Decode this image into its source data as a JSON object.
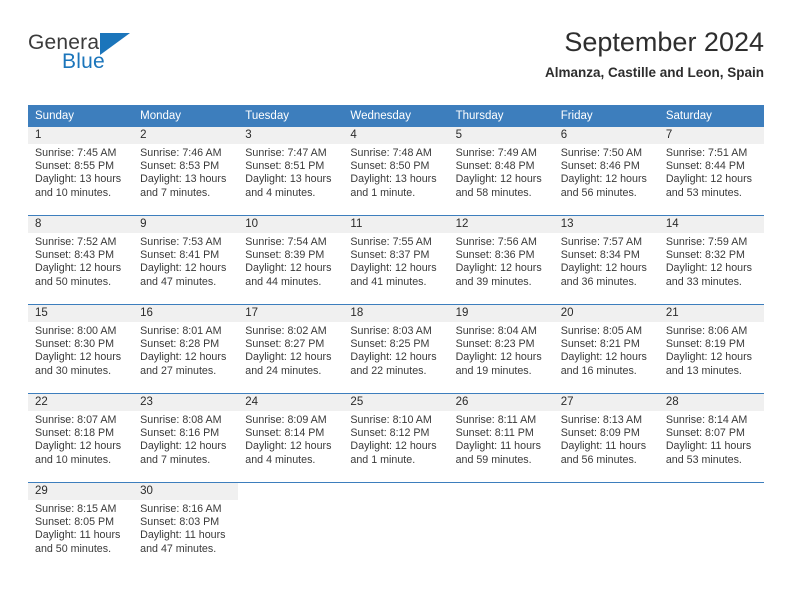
{
  "brand": {
    "name_top": "General",
    "name_bottom": "Blue",
    "color_top": "#3b3b3b",
    "color_bottom": "#1b75bb",
    "triangle_color": "#1b75bb"
  },
  "header": {
    "title": "September 2024",
    "subtitle": "Almanza, Castille and Leon, Spain"
  },
  "theme": {
    "header_bg": "#3d7ebd",
    "header_text": "#ffffff",
    "daynum_band_bg": "#f0f0f0",
    "week_separator": "#3d7ebd",
    "body_text": "#3a3a3a"
  },
  "weekday_headers": [
    "Sunday",
    "Monday",
    "Tuesday",
    "Wednesday",
    "Thursday",
    "Friday",
    "Saturday"
  ],
  "weeks": [
    [
      {
        "day": "1",
        "sunrise": "Sunrise: 7:45 AM",
        "sunset": "Sunset: 8:55 PM",
        "daylight": "Daylight: 13 hours and 10 minutes."
      },
      {
        "day": "2",
        "sunrise": "Sunrise: 7:46 AM",
        "sunset": "Sunset: 8:53 PM",
        "daylight": "Daylight: 13 hours and 7 minutes."
      },
      {
        "day": "3",
        "sunrise": "Sunrise: 7:47 AM",
        "sunset": "Sunset: 8:51 PM",
        "daylight": "Daylight: 13 hours and 4 minutes."
      },
      {
        "day": "4",
        "sunrise": "Sunrise: 7:48 AM",
        "sunset": "Sunset: 8:50 PM",
        "daylight": "Daylight: 13 hours and 1 minute."
      },
      {
        "day": "5",
        "sunrise": "Sunrise: 7:49 AM",
        "sunset": "Sunset: 8:48 PM",
        "daylight": "Daylight: 12 hours and 58 minutes."
      },
      {
        "day": "6",
        "sunrise": "Sunrise: 7:50 AM",
        "sunset": "Sunset: 8:46 PM",
        "daylight": "Daylight: 12 hours and 56 minutes."
      },
      {
        "day": "7",
        "sunrise": "Sunrise: 7:51 AM",
        "sunset": "Sunset: 8:44 PM",
        "daylight": "Daylight: 12 hours and 53 minutes."
      }
    ],
    [
      {
        "day": "8",
        "sunrise": "Sunrise: 7:52 AM",
        "sunset": "Sunset: 8:43 PM",
        "daylight": "Daylight: 12 hours and 50 minutes."
      },
      {
        "day": "9",
        "sunrise": "Sunrise: 7:53 AM",
        "sunset": "Sunset: 8:41 PM",
        "daylight": "Daylight: 12 hours and 47 minutes."
      },
      {
        "day": "10",
        "sunrise": "Sunrise: 7:54 AM",
        "sunset": "Sunset: 8:39 PM",
        "daylight": "Daylight: 12 hours and 44 minutes."
      },
      {
        "day": "11",
        "sunrise": "Sunrise: 7:55 AM",
        "sunset": "Sunset: 8:37 PM",
        "daylight": "Daylight: 12 hours and 41 minutes."
      },
      {
        "day": "12",
        "sunrise": "Sunrise: 7:56 AM",
        "sunset": "Sunset: 8:36 PM",
        "daylight": "Daylight: 12 hours and 39 minutes."
      },
      {
        "day": "13",
        "sunrise": "Sunrise: 7:57 AM",
        "sunset": "Sunset: 8:34 PM",
        "daylight": "Daylight: 12 hours and 36 minutes."
      },
      {
        "day": "14",
        "sunrise": "Sunrise: 7:59 AM",
        "sunset": "Sunset: 8:32 PM",
        "daylight": "Daylight: 12 hours and 33 minutes."
      }
    ],
    [
      {
        "day": "15",
        "sunrise": "Sunrise: 8:00 AM",
        "sunset": "Sunset: 8:30 PM",
        "daylight": "Daylight: 12 hours and 30 minutes."
      },
      {
        "day": "16",
        "sunrise": "Sunrise: 8:01 AM",
        "sunset": "Sunset: 8:28 PM",
        "daylight": "Daylight: 12 hours and 27 minutes."
      },
      {
        "day": "17",
        "sunrise": "Sunrise: 8:02 AM",
        "sunset": "Sunset: 8:27 PM",
        "daylight": "Daylight: 12 hours and 24 minutes."
      },
      {
        "day": "18",
        "sunrise": "Sunrise: 8:03 AM",
        "sunset": "Sunset: 8:25 PM",
        "daylight": "Daylight: 12 hours and 22 minutes."
      },
      {
        "day": "19",
        "sunrise": "Sunrise: 8:04 AM",
        "sunset": "Sunset: 8:23 PM",
        "daylight": "Daylight: 12 hours and 19 minutes."
      },
      {
        "day": "20",
        "sunrise": "Sunrise: 8:05 AM",
        "sunset": "Sunset: 8:21 PM",
        "daylight": "Daylight: 12 hours and 16 minutes."
      },
      {
        "day": "21",
        "sunrise": "Sunrise: 8:06 AM",
        "sunset": "Sunset: 8:19 PM",
        "daylight": "Daylight: 12 hours and 13 minutes."
      }
    ],
    [
      {
        "day": "22",
        "sunrise": "Sunrise: 8:07 AM",
        "sunset": "Sunset: 8:18 PM",
        "daylight": "Daylight: 12 hours and 10 minutes."
      },
      {
        "day": "23",
        "sunrise": "Sunrise: 8:08 AM",
        "sunset": "Sunset: 8:16 PM",
        "daylight": "Daylight: 12 hours and 7 minutes."
      },
      {
        "day": "24",
        "sunrise": "Sunrise: 8:09 AM",
        "sunset": "Sunset: 8:14 PM",
        "daylight": "Daylight: 12 hours and 4 minutes."
      },
      {
        "day": "25",
        "sunrise": "Sunrise: 8:10 AM",
        "sunset": "Sunset: 8:12 PM",
        "daylight": "Daylight: 12 hours and 1 minute."
      },
      {
        "day": "26",
        "sunrise": "Sunrise: 8:11 AM",
        "sunset": "Sunset: 8:11 PM",
        "daylight": "Daylight: 11 hours and 59 minutes."
      },
      {
        "day": "27",
        "sunrise": "Sunrise: 8:13 AM",
        "sunset": "Sunset: 8:09 PM",
        "daylight": "Daylight: 11 hours and 56 minutes."
      },
      {
        "day": "28",
        "sunrise": "Sunrise: 8:14 AM",
        "sunset": "Sunset: 8:07 PM",
        "daylight": "Daylight: 11 hours and 53 minutes."
      }
    ],
    [
      {
        "day": "29",
        "sunrise": "Sunrise: 8:15 AM",
        "sunset": "Sunset: 8:05 PM",
        "daylight": "Daylight: 11 hours and 50 minutes."
      },
      {
        "day": "30",
        "sunrise": "Sunrise: 8:16 AM",
        "sunset": "Sunset: 8:03 PM",
        "daylight": "Daylight: 11 hours and 47 minutes."
      },
      {
        "day": "",
        "sunrise": "",
        "sunset": "",
        "daylight": ""
      },
      {
        "day": "",
        "sunrise": "",
        "sunset": "",
        "daylight": ""
      },
      {
        "day": "",
        "sunrise": "",
        "sunset": "",
        "daylight": ""
      },
      {
        "day": "",
        "sunrise": "",
        "sunset": "",
        "daylight": ""
      },
      {
        "day": "",
        "sunrise": "",
        "sunset": "",
        "daylight": ""
      }
    ]
  ]
}
